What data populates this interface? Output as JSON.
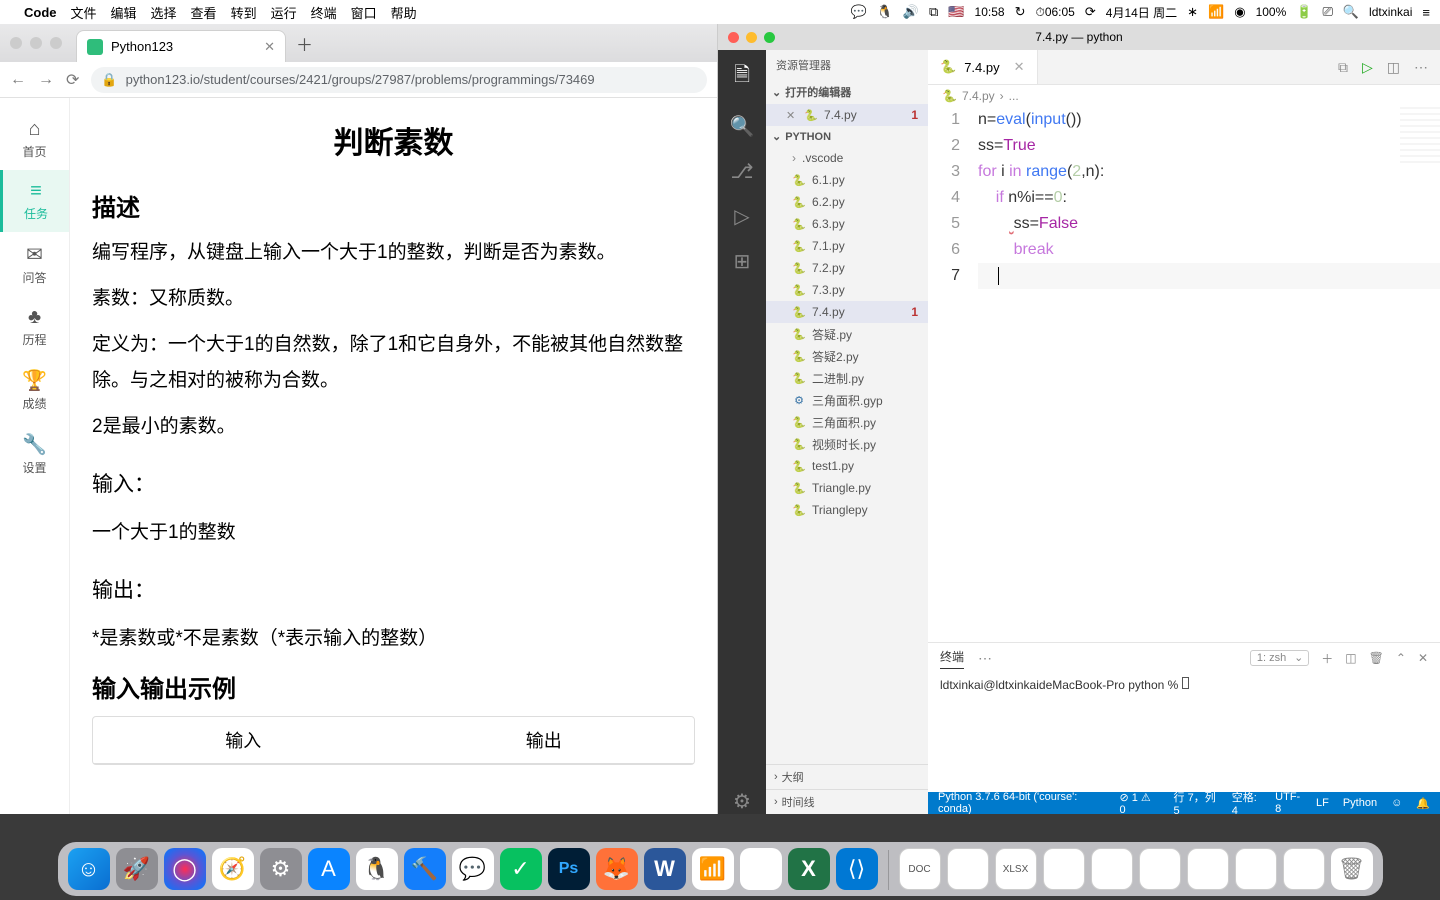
{
  "menubar": {
    "apple": "",
    "app": "Code",
    "items": [
      "文件",
      "编辑",
      "选择",
      "查看",
      "转到",
      "运行",
      "终端",
      "窗口",
      "帮助"
    ],
    "right": {
      "time": "10:58",
      "timer": "⏱06:05",
      "date": "4月14日 周二",
      "battery": "100%",
      "user": "ldtxinkai"
    }
  },
  "browser": {
    "tab": {
      "title": "Python123"
    },
    "url": "python123.io/student/courses/2421/groups/27987/problems/programmings/73469",
    "sidenav": [
      {
        "icon": "⌂",
        "label": "首页"
      },
      {
        "icon": "≡",
        "label": "任务"
      },
      {
        "icon": "✉",
        "label": "问答"
      },
      {
        "icon": "♣",
        "label": "历程"
      },
      {
        "icon": "🏆",
        "label": "成绩"
      },
      {
        "icon": "🔧",
        "label": "设置"
      }
    ],
    "content": {
      "title": "判断素数",
      "h_desc": "描述",
      "p1": "编写程序，从键盘上输入一个大于1的整数，判断是否为素数。",
      "p2": "素数：又称质数。",
      "p3": "定义为：一个大于1的自然数，除了1和它自身外，不能被其他自然数整除。与之相对的被称为合数。",
      "p4": "2是最小的素数。",
      "h_in": "输入：",
      "p_in": "一个大于1的整数",
      "h_out": "输出：",
      "p_out": " *是素数或*不是素数（*表示输入的整数）",
      "h_io": "输入输出示例",
      "io_in": "输入",
      "io_out": "输出"
    }
  },
  "vscode": {
    "title": "7.4.py — python",
    "explorer": {
      "title": "资源管理器",
      "open_editors": "打开的编辑器",
      "open_file": {
        "name": "7.4.py",
        "badge": "1"
      },
      "project": "PYTHON",
      "folder": ".vscode",
      "files": [
        "6.1.py",
        "6.2.py",
        "6.3.py",
        "7.1.py",
        "7.2.py",
        "7.3.py",
        "7.4.py",
        "答疑.py",
        "答疑2.py",
        "二进制.py",
        "三角面积.gyp",
        "三角面积.py",
        "视频时长.py",
        "test1.py",
        "Triangle.py",
        "Trianglepy"
      ],
      "active_file_index": 6,
      "outline": "大纲",
      "timeline": "时间线"
    },
    "tab": {
      "name": "7.4.py"
    },
    "breadcrumb": {
      "file": "7.4.py",
      "rest": "..."
    },
    "toolbar": {
      "run": "▷"
    },
    "code_lines": [
      "1",
      "2",
      "3",
      "4",
      "5",
      "6",
      "7"
    ],
    "code": {
      "l1": "n=eval(input())",
      "l2": "ss=True",
      "l3": "for i in range(2,n):",
      "l4": "    if n%i==0:",
      "l5a": "        ",
      "l5b": "ss=False",
      "l6": "        break",
      "l7": ""
    },
    "panel": {
      "tab": "终端",
      "select": "1: zsh",
      "prompt": "ldtxinkai@ldtxinkaideMacBook-Pro python % "
    },
    "status": {
      "python": "Python 3.7.6 64-bit ('course': conda)",
      "errs": "⊘ 1  ⚠ 0",
      "pos": "行 7，列 5",
      "spaces": "空格: 4",
      "enc": "UTF-8",
      "eol": "LF",
      "lang": "Python",
      "feedback": "☺"
    }
  },
  "dock": [
    {
      "cls": "di-finder",
      "glyph": "☺",
      "name": "finder"
    },
    {
      "cls": "di-launchpad",
      "glyph": "🚀",
      "name": "launchpad"
    },
    {
      "cls": "di-siri",
      "glyph": "◯",
      "name": "siri"
    },
    {
      "cls": "di-safari",
      "glyph": "🧭",
      "name": "safari"
    },
    {
      "cls": "di-settings",
      "glyph": "⚙",
      "name": "settings"
    },
    {
      "cls": "di-appstore",
      "glyph": "A",
      "name": "appstore"
    },
    {
      "cls": "di-qq",
      "glyph": "🐧",
      "name": "qq"
    },
    {
      "cls": "di-xcode",
      "glyph": "🔨",
      "name": "xcode"
    },
    {
      "cls": "di-wechat2",
      "glyph": "💬",
      "name": "messages"
    },
    {
      "cls": "di-wechat",
      "glyph": "✓",
      "name": "wechat"
    },
    {
      "cls": "di-ps",
      "glyph": "Ps",
      "name": "photoshop"
    },
    {
      "cls": "di-firefox",
      "glyph": "🦊",
      "name": "firefox"
    },
    {
      "cls": "di-word",
      "glyph": "W",
      "name": "word"
    },
    {
      "cls": "di-wifi",
      "glyph": "📶",
      "name": "wifi-util"
    },
    {
      "cls": "di-chrome",
      "glyph": "◉",
      "name": "chrome"
    },
    {
      "cls": "di-excel",
      "glyph": "X",
      "name": "excel"
    },
    {
      "cls": "di-vscode",
      "glyph": "⟨⟩",
      "name": "vscode"
    }
  ],
  "dock_right": [
    {
      "cls": "di-doc",
      "glyph": "DOC",
      "name": "doc1"
    },
    {
      "cls": "di-doc",
      "glyph": "",
      "name": "doc2"
    },
    {
      "cls": "di-doc",
      "glyph": "XLSX",
      "name": "doc3"
    },
    {
      "cls": "di-doc",
      "glyph": "",
      "name": "doc4"
    },
    {
      "cls": "di-doc",
      "glyph": "",
      "name": "doc5"
    },
    {
      "cls": "di-doc",
      "glyph": "",
      "name": "doc6"
    },
    {
      "cls": "di-doc",
      "glyph": "",
      "name": "doc7"
    },
    {
      "cls": "di-doc",
      "glyph": "",
      "name": "doc8"
    },
    {
      "cls": "di-doc",
      "glyph": "",
      "name": "doc9"
    },
    {
      "cls": "di-trash",
      "glyph": "🗑",
      "name": "trash"
    }
  ]
}
